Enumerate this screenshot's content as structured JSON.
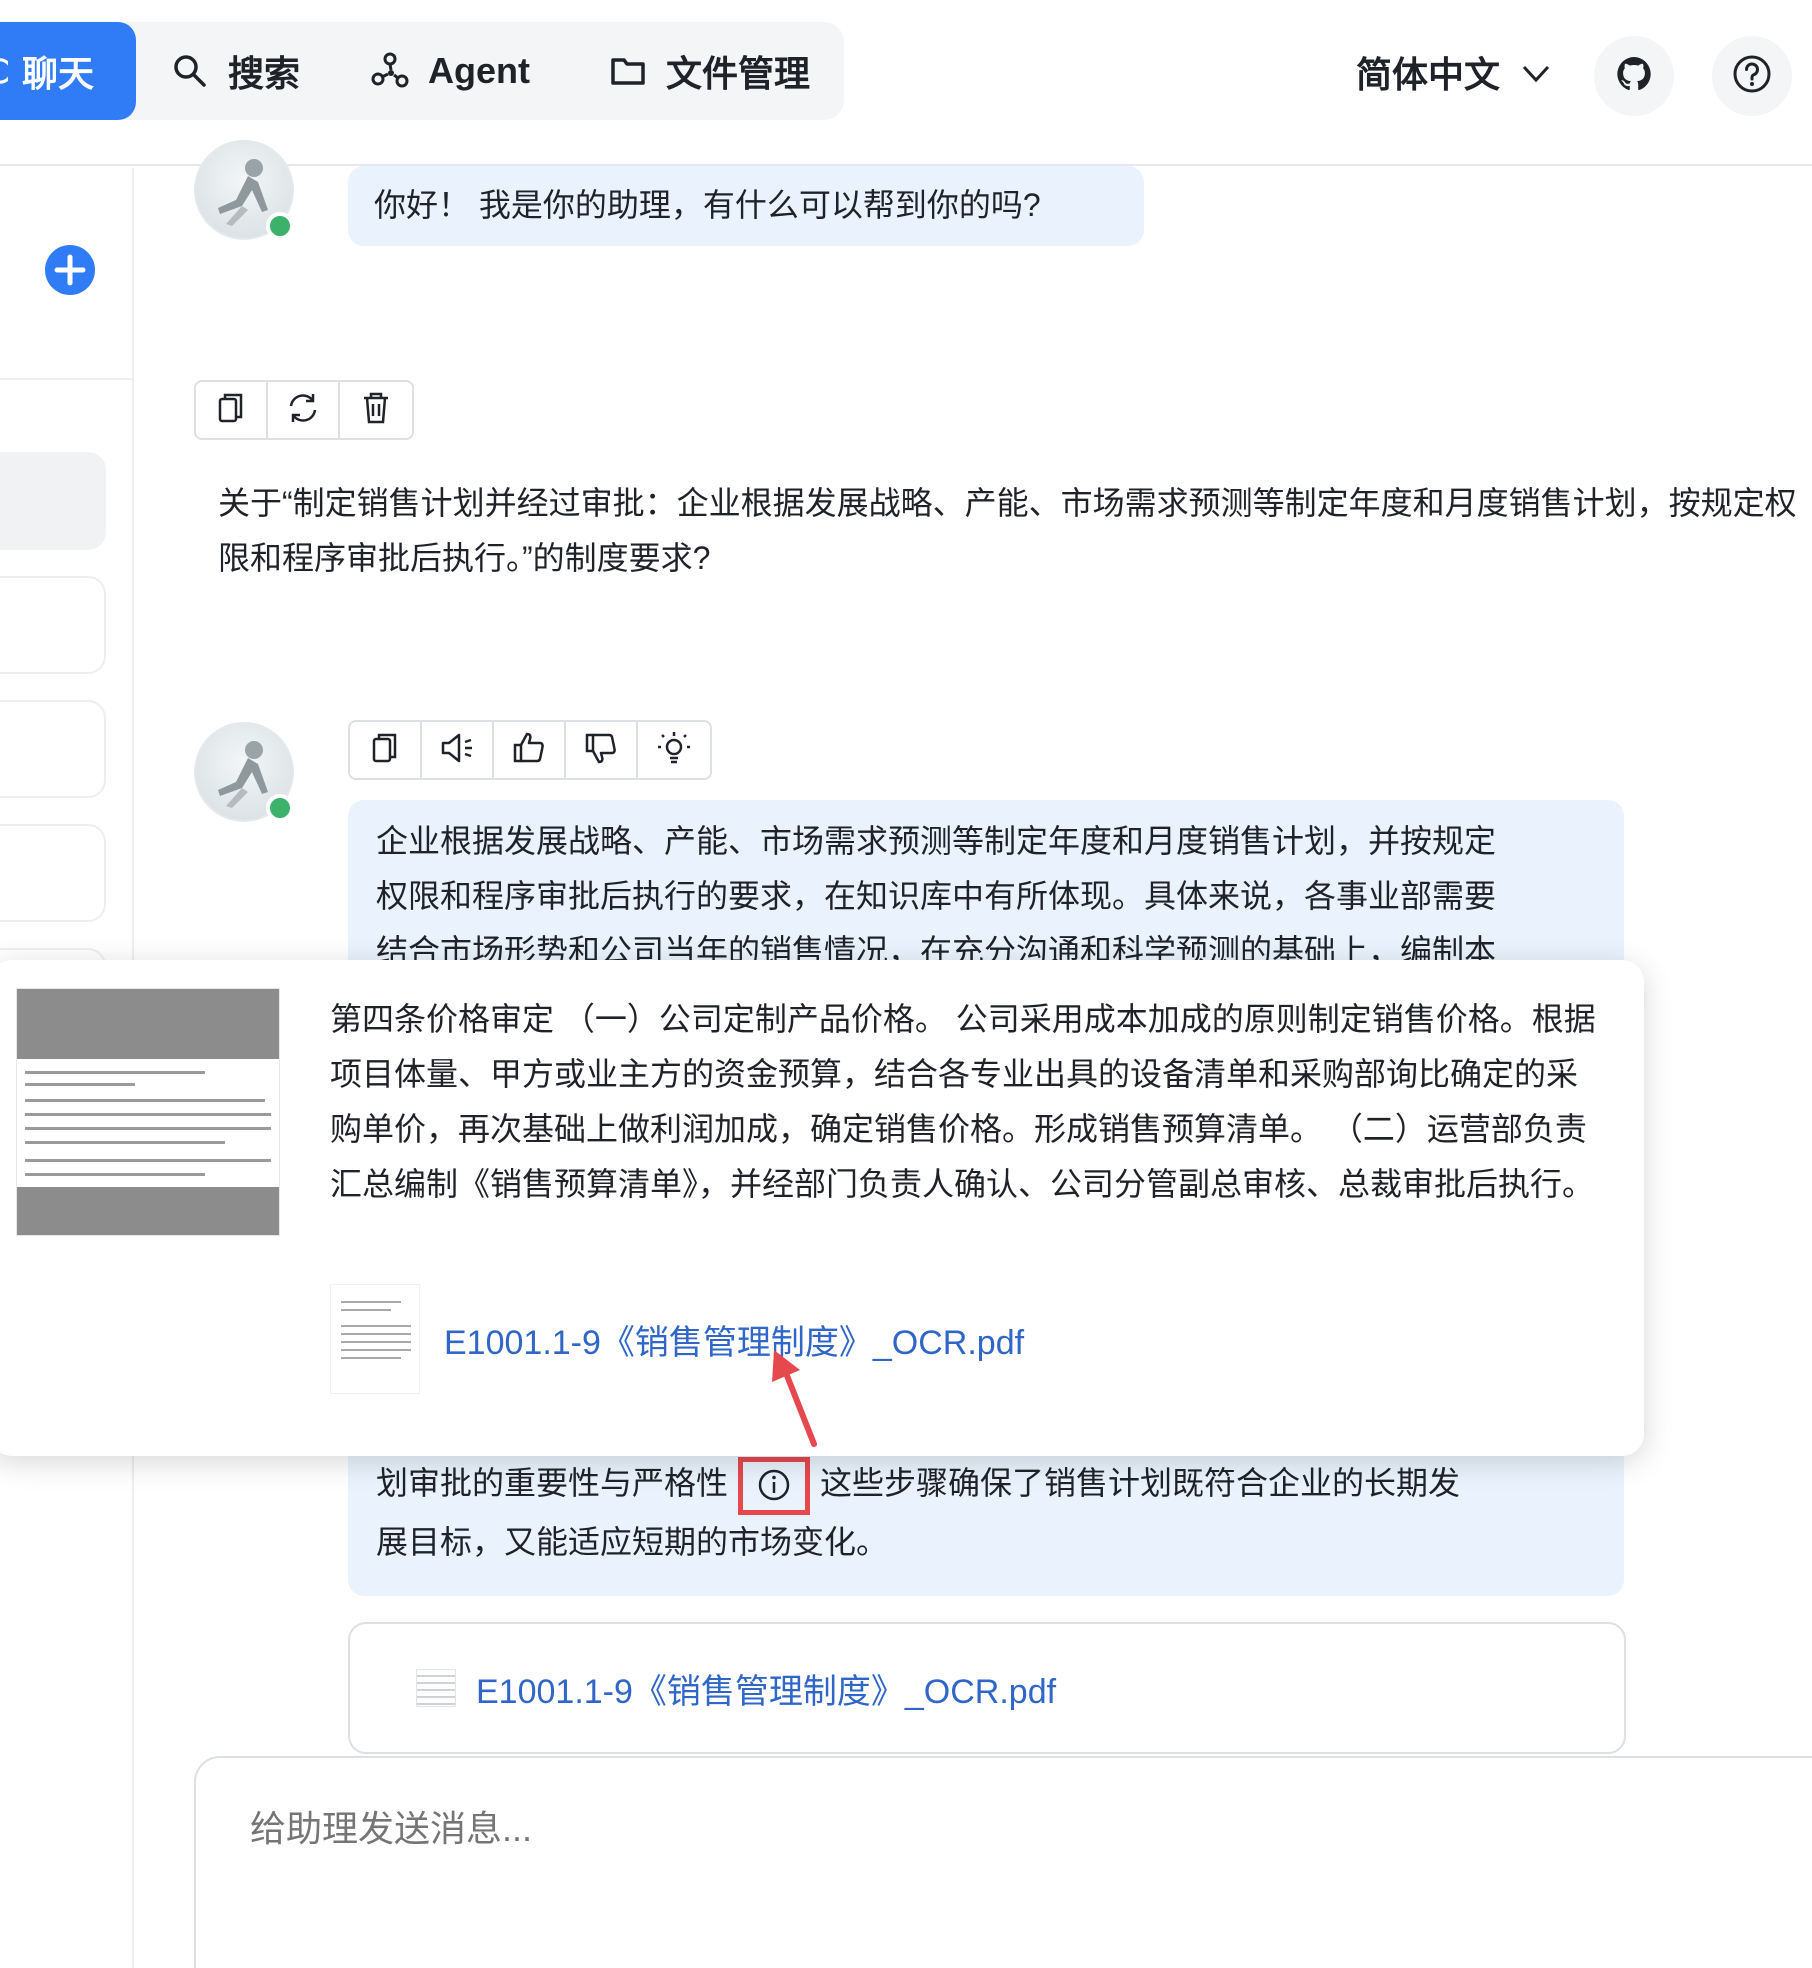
{
  "nav": {
    "tabs": [
      {
        "label": "聊天",
        "icon": "chat-icon"
      },
      {
        "label": "搜索",
        "icon": "search-icon"
      },
      {
        "label": "Agent",
        "icon": "agent-icon"
      },
      {
        "label": "文件管理",
        "icon": "folder-icon"
      }
    ],
    "language": "简体中文",
    "accent_color": "#2f7cf6"
  },
  "chat": {
    "greeting": "你好！ 我是你的助理，有什么可以帮到你的吗?",
    "user_message": "关于“制定销售计划并经过审批：企业根据发展战略、产能、市场需求预测等制定年度和月度销售计划，按规定权限和程序审批后执行。”的制度要求?",
    "answer_lines": [
      "企业根据发展战略、产能、市场需求预测等制定年度和月度销售计划，并按规定",
      "权限和程序审批后执行的要求，在知识库中有所体现。具体来说，各事业部需要",
      "结合市场形势和公司当年的销售情况，在充分沟通和科学预测的基础上，编制本"
    ],
    "answer_tail_before_cite": "划审批的重要性与严格性",
    "answer_tail_after_cite": "这些步骤确保了销售计划既符合企业的长期发",
    "answer_tail_last": "展目标，又能适应短期的市场变化。",
    "file_card_name": "E1001.1-9《销售管理制度》_OCR.pdf"
  },
  "popover": {
    "text": "第四条价格审定 （一）公司定制产品价格。 公司采用成本加成的原则制定销售价格。根据项目体量、甲方或业主方的资金预算，结合各专业出具的设备清单和采购部询比确定的采购单价，再次基础上做利润加成，确定销售价格。形成销售预算清单。 （二）运营部负责汇总编制《销售预算清单》，并经部门负责人确认、公司分管副总审核、总裁审批后执行。",
    "file_name": "E1001.1-9《销售管理制度》_OCR.pdf"
  },
  "composer": {
    "placeholder": "给助理发送消息..."
  }
}
